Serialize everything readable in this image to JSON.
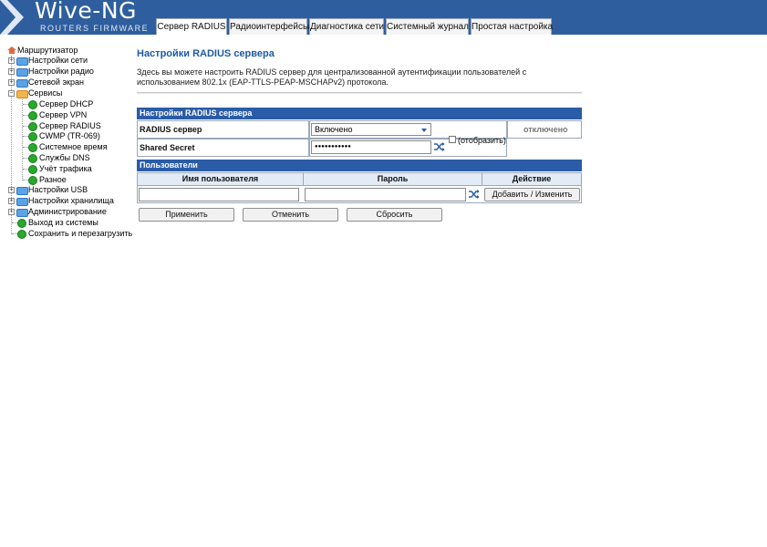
{
  "logo": {
    "title": "Wive-NG",
    "subtitle": "ROUTERS FIRMWARE"
  },
  "tabs": [
    {
      "label": "Сервер RADIUS",
      "active": true
    },
    {
      "label": "Радиоинтерфейсы"
    },
    {
      "label": "Диагностика сети"
    },
    {
      "label": "Системный журнал"
    },
    {
      "label": "Простая настройка"
    }
  ],
  "sidebar": {
    "root": "Маршрутизатор",
    "items": [
      {
        "label": "Настройки сети",
        "icon": "folder-icon",
        "expander": "+"
      },
      {
        "label": "Настройки радио",
        "icon": "folder-icon",
        "expander": "+"
      },
      {
        "label": "Сетевой экран",
        "icon": "folder-icon",
        "expander": "+"
      },
      {
        "label": "Сервисы",
        "icon": "open-folder-icon",
        "expander": "−",
        "children": [
          "Сервер DHCP",
          "Сервер VPN",
          "Сервер RADIUS",
          "CWMP (TR-069)",
          "Системное время",
          "Службы DNS",
          "Учёт трафика",
          "Разное"
        ]
      },
      {
        "label": "Настройки USB",
        "icon": "folder-icon",
        "expander": "+"
      },
      {
        "label": "Настройки хранилища",
        "icon": "folder-icon",
        "expander": "+"
      },
      {
        "label": "Администрирование",
        "icon": "folder-icon",
        "expander": "+"
      },
      {
        "label": "Выход из системы",
        "icon": "leaf-icon"
      },
      {
        "label": "Сохранить и перезагрузить",
        "icon": "leaf-icon"
      }
    ]
  },
  "main": {
    "title": "Настройки RADIUS сервера",
    "description": "Здесь вы можете настроить RADIUS сервер для централизованной аутентификации пользователей с использованием 802.1x (EAP-TTLS-PEAP-MSCHAPv2) протокола.",
    "settings_header": "Настройки RADIUS сервера",
    "radius_label": "RADIUS сервер",
    "radius_value": "Включено",
    "status": "отключено",
    "secret_label": "Shared Secret",
    "secret_value": "●●●●●●●●●●●",
    "show_label": "(отобразить)",
    "users_header": "Пользователи",
    "col_user": "Имя пользователя",
    "col_password": "Пароль",
    "col_action": "Действие",
    "user_input": "",
    "password_input": "",
    "add_button": "Добавить / Изменить",
    "apply_button": "Применить",
    "cancel_button": "Отменить",
    "reset_button": "Сбросить"
  },
  "colors": {
    "header_bg": "#2e5e9e",
    "section_header": "#2a5ca8",
    "title": "#1d5aa5"
  }
}
